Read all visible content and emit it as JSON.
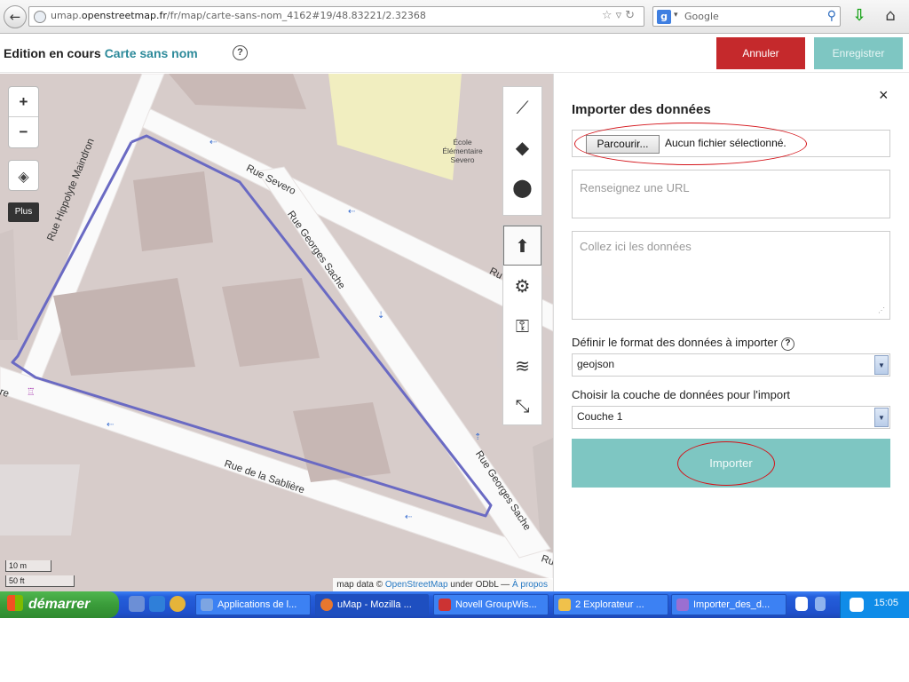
{
  "browser": {
    "url_prefix": "umap.",
    "url_domain": "openstreetmap.fr",
    "url_path": "/fr/map/carte-sans-nom_4162#19/48.83221/2.32368",
    "search_placeholder": "Google"
  },
  "header": {
    "edit_label": "Edition en cours",
    "map_name": "Carte sans nom",
    "help": "?",
    "cancel_label": "Annuler",
    "save_label": "Enregistrer"
  },
  "map": {
    "zoom_in": "+",
    "zoom_out": "−",
    "more_label": "Plus",
    "streets": {
      "hippolyte": "Rue Hippolyte Maindron",
      "severo": "Rue Severo",
      "georges_sache_1": "Rue Georges Sache",
      "georges_sache_2": "Rue Georges Sache",
      "sabliere": "Rue de la Sablière",
      "edge_ru": "Ru",
      "edge_re": "re",
      "edge_sab": "Rue de la Sablière"
    },
    "poi": "École Élémentaire Severo",
    "scale_metric": "10 m",
    "scale_imperial": "50 ft",
    "attribution_prefix": "map data ©",
    "attribution_link": "OpenStreetMap",
    "attribution_mid": "under ODbL —",
    "attribution_about": "À propos",
    "polygon_color": "#6a6ac3"
  },
  "panel": {
    "close": "×",
    "title": "Importer des données",
    "browse_label": "Parcourir...",
    "no_file": "Aucun fichier sélectionné.",
    "url_placeholder": "Renseignez une URL",
    "paste_placeholder": "Collez ici les données",
    "format_label": "Définir le format des données à importer",
    "format_value": "geojson",
    "layer_label": "Choisir la couche de données pour l'import",
    "layer_value": "Couche 1",
    "import_label": "Importer"
  },
  "taskbar": {
    "start": "démarrer",
    "tasks": [
      "Applications de l...",
      "uMap - Mozilla ...",
      "Novell GroupWis...",
      "2 Explorateur ...",
      "Importer_des_d..."
    ],
    "clock": "15:05"
  },
  "colors": {
    "accent": "#2d8a9a",
    "danger": "#c5292c",
    "teal": "#7ec6c2",
    "annotation": "#d4141a"
  }
}
